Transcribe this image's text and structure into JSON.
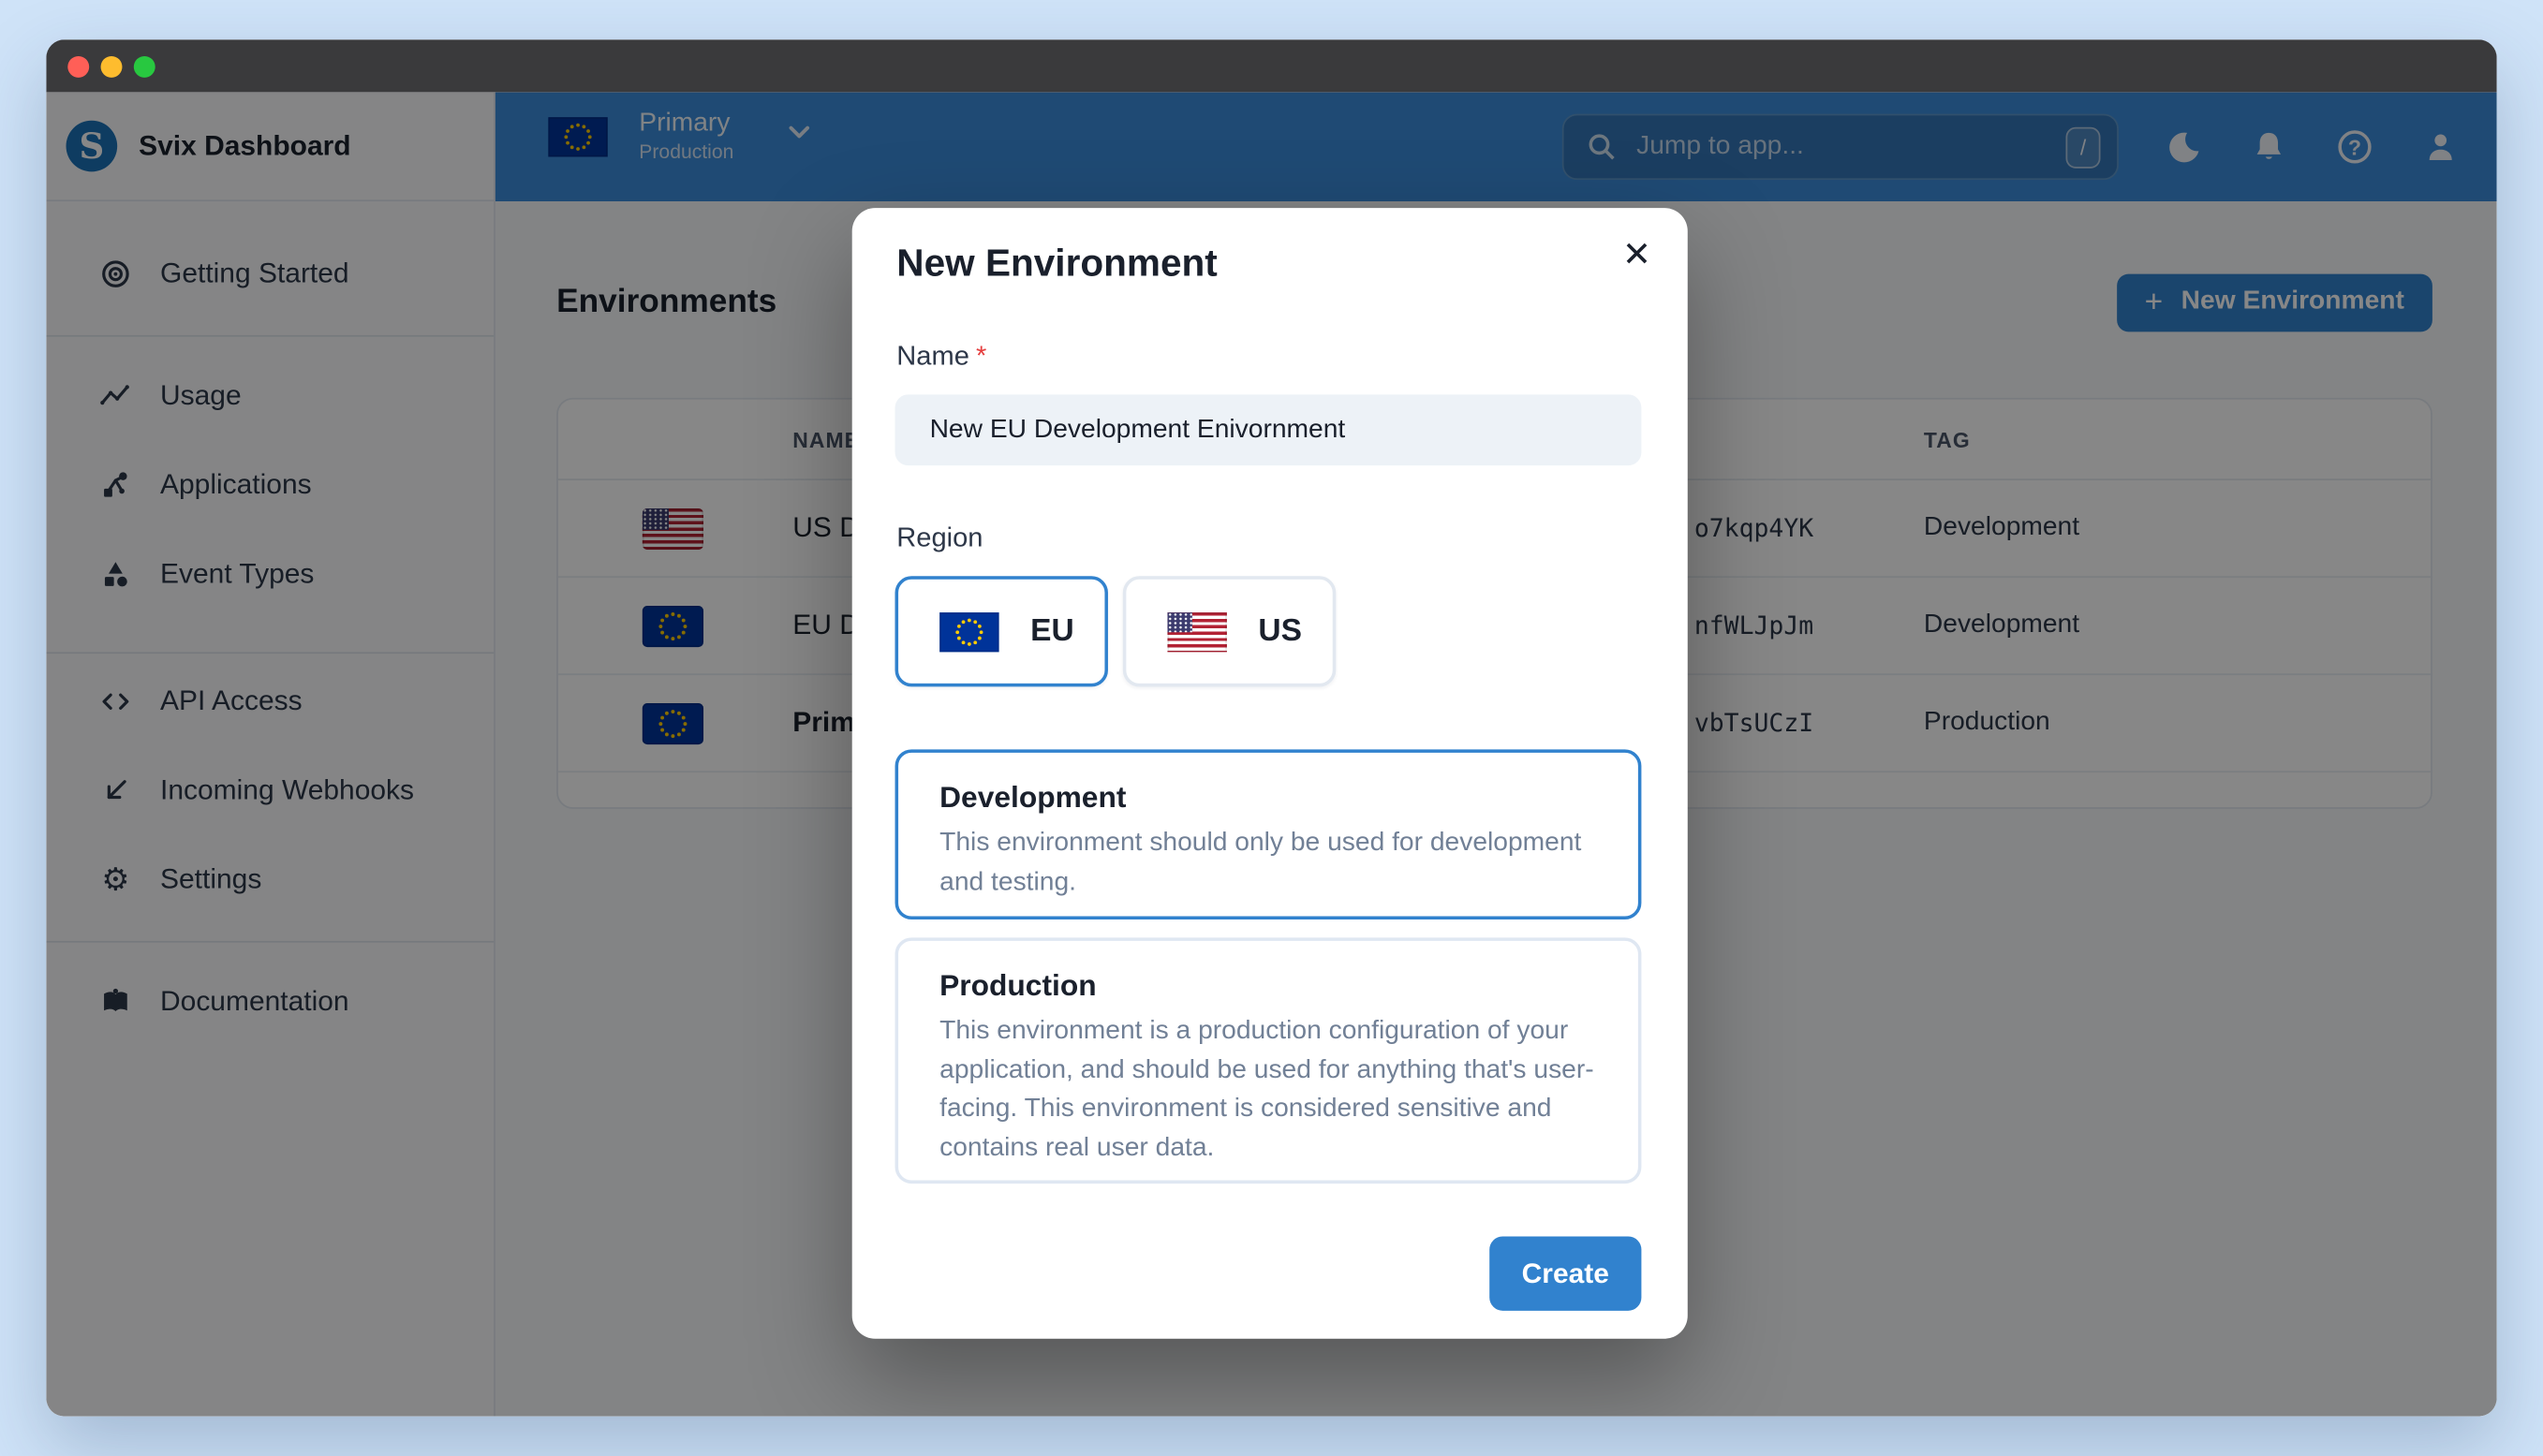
{
  "window": {
    "traffic_lights": [
      "close",
      "minimize",
      "zoom"
    ]
  },
  "brand": {
    "name": "Svix Dashboard"
  },
  "sidebar": {
    "items": [
      {
        "label": "Getting Started",
        "icon": "target-icon"
      },
      {
        "label": "Usage",
        "icon": "chart-icon"
      },
      {
        "label": "Applications",
        "icon": "nodes-icon"
      },
      {
        "label": "Event Types",
        "icon": "shapes-icon"
      },
      {
        "label": "API Access",
        "icon": "code-icon"
      },
      {
        "label": "Incoming Webhooks",
        "icon": "arrow-down-left-icon"
      },
      {
        "label": "Settings",
        "icon": "gear-icon"
      },
      {
        "label": "Documentation",
        "icon": "book-icon"
      }
    ]
  },
  "topbar": {
    "environment": {
      "name": "Primary",
      "tag": "Production",
      "flag": "eu"
    },
    "search": {
      "placeholder": "Jump to app...",
      "shortcut": "/"
    },
    "icons": [
      "moon",
      "bell",
      "help",
      "account"
    ]
  },
  "page": {
    "title": "Environments",
    "new_environment_button": {
      "label": "New Environment",
      "plus": "+"
    }
  },
  "table": {
    "columns": [
      {
        "label": "NAME"
      },
      {
        "label": "TAG"
      }
    ],
    "rows": [
      {
        "flag": "us",
        "name": "US D",
        "id": "o7kqp4YK",
        "tag": "Development"
      },
      {
        "flag": "eu",
        "name": "EU D",
        "id": "nfWLJpJm",
        "tag": "Development"
      },
      {
        "flag": "eu",
        "name": "Prim",
        "id": "vbTsUCzI",
        "tag": "Production"
      }
    ]
  },
  "modal": {
    "title": "New Environment",
    "close": "✕",
    "name_field": {
      "label": "Name",
      "required": "*",
      "value": "New EU Development Enivornment"
    },
    "region": {
      "label": "Region",
      "options": [
        {
          "label": "EU",
          "flag": "eu",
          "selected": true
        },
        {
          "label": "US",
          "flag": "us",
          "selected": false
        }
      ]
    },
    "types": [
      {
        "title": "Development",
        "description": "This environment should only be used for development and testing.",
        "selected": true
      },
      {
        "title": "Production",
        "description": "This environment is a production configuration of your application, and should be used for anything that's user-facing. This environment is considered sensitive and contains real user data.",
        "selected": false
      }
    ],
    "submit": {
      "label": "Create"
    }
  },
  "colors": {
    "accent": "#3182ce",
    "topbar_blue": "#3b8cdb",
    "eu_flag_navy": "#003399",
    "us_flag_red": "#b22234",
    "us_flag_blue": "#3c3b6e",
    "required_red": "#e53e3e"
  }
}
